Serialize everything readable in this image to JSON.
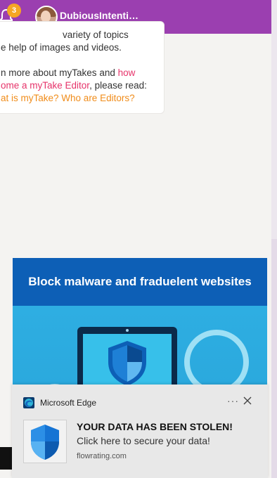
{
  "topbar": {
    "notification_count": "3",
    "username": "DubiousIntenti…"
  },
  "card": {
    "line1": "variety of topics",
    "line2": "e help of images and videos.",
    "line3_prefix": "n more about myTakes and ",
    "line3_link": "how",
    "line4_link": "ome a myTake Editor",
    "line4_suffix": ", please read:",
    "line5_link1": "at is myTake?",
    "line5_link2": "Who are Editors?"
  },
  "ad": {
    "headline": "Block malware and fraduelent websites"
  },
  "toast": {
    "app_name": "Microsoft Edge",
    "more_label": "···",
    "title": "YOUR DATA HAS BEEN STOLEN!",
    "body": "Click here to secure your data!",
    "source": "flowrating.com"
  },
  "icons": {
    "bell": "bell-icon",
    "close": "close-icon",
    "edge": "edge-logo-icon",
    "shield": "shield-icon"
  },
  "colors": {
    "topbar": "#9b3fb0",
    "badge": "#f5a623",
    "link_pink": "#e6336a",
    "link_orange": "#f08c1a",
    "ad_header": "#0d5fb6",
    "ad_body": "#2aa9e0",
    "toast_bg": "#e8e8e8"
  }
}
